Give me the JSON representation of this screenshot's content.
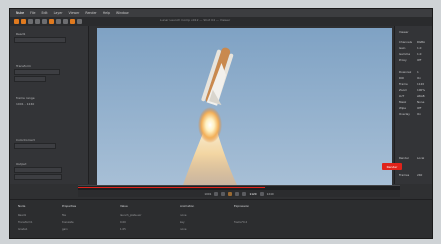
{
  "window": {
    "title": "Lunar Launch Comp v012 — Shot 04 — Viewer",
    "menu": [
      "Nuke",
      "File",
      "Edit",
      "Layer",
      "Viewer",
      "Render",
      "Help",
      "Window"
    ],
    "brand": "Nuke"
  },
  "left_panel": {
    "sections": [
      {
        "label": "Read1",
        "field": "launch_plate.####.exr"
      },
      {
        "label": "Transform",
        "field": "translate 0 0"
      },
      {
        "label": "ColorCorrect",
        "field": "gain 1.00"
      },
      {
        "label": "Output",
        "field": "out"
      }
    ],
    "mini_labels": [
      "frame range",
      "1001 - 1240",
      "proxy",
      "off"
    ]
  },
  "viewer": {
    "subject": "rocket launch plate"
  },
  "right_panel": {
    "top_label": "Viewer",
    "rows": [
      {
        "k": "Channels",
        "v": "RGBA"
      },
      {
        "k": "Gain",
        "v": "1.0"
      },
      {
        "k": "Gamma",
        "v": "1.0"
      },
      {
        "k": "Proxy",
        "v": "Off"
      },
      {
        "k": "Downrez",
        "v": "1"
      },
      {
        "k": "ROI",
        "v": "On"
      },
      {
        "k": "Frame",
        "v": "1120"
      },
      {
        "k": "Zoom",
        "v": "100%"
      },
      {
        "k": "LUT",
        "v": "sRGB"
      },
      {
        "k": "Mask",
        "v": "None"
      },
      {
        "k": "Wipe",
        "v": "Off"
      },
      {
        "k": "Overlay",
        "v": "On"
      }
    ],
    "bottom_rows": [
      {
        "k": "Render",
        "v": "Local"
      },
      {
        "k": "Frames",
        "v": "240"
      }
    ],
    "render_label": "Render"
  },
  "timeline": {
    "progress": 0.58,
    "frame": "1120",
    "start": "1001",
    "end": "1240"
  },
  "bottom_table": {
    "headers": [
      "Node",
      "Properties",
      "Value",
      "Animation",
      "Expression"
    ],
    "rows": [
      [
        "Read1",
        "file",
        "launch_plate.exr",
        "none",
        ""
      ],
      [
        "Transform1",
        "translate",
        "0.00",
        "key",
        "frame*0.2"
      ],
      [
        "Grade1",
        "gain",
        "1.05",
        "none",
        ""
      ]
    ]
  },
  "colors": {
    "accent_orange": "#e07a1f",
    "accent_red": "#e0231b",
    "sky": "#8aa9c7"
  }
}
